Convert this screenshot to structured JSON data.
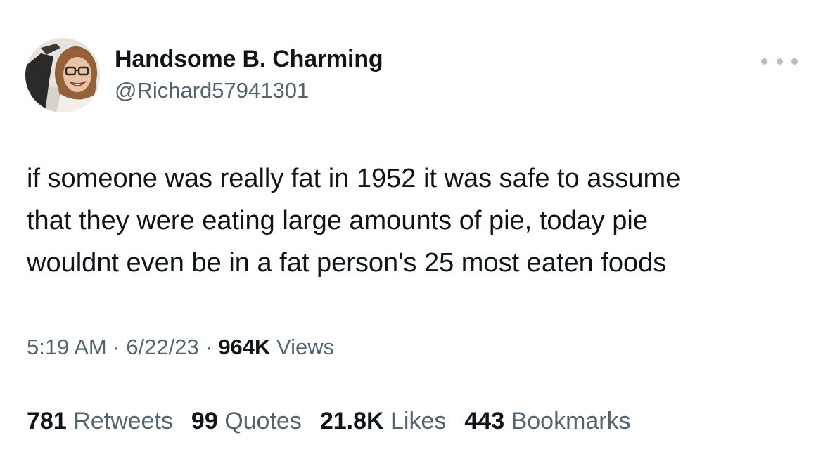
{
  "author": {
    "display_name": "Handsome B. Charming",
    "handle": "@Richard57941301"
  },
  "tweet": {
    "text": "if someone was really fat in 1952 it was safe to assume\nthat they were eating large amounts of pie, today pie\nwouldnt even be in a fat person's 25 most eaten foods"
  },
  "meta": {
    "time": "5:19 AM",
    "sep1": " · ",
    "date": "6/22/23",
    "sep2": " · ",
    "views_count": "964K",
    "views_label": " Views"
  },
  "stats": {
    "retweets": {
      "count": "781",
      "label": "Retweets"
    },
    "quotes": {
      "count": "99",
      "label": "Quotes"
    },
    "likes": {
      "count": "21.8K",
      "label": "Likes"
    },
    "bookmarks": {
      "count": "443",
      "label": "Bookmarks"
    }
  },
  "icons": {
    "more": "more-horizontal-icon",
    "avatar": "profile-photo"
  },
  "colors": {
    "text_primary": "#0f1419",
    "text_secondary": "#536471",
    "divider": "#e6e9eb"
  }
}
